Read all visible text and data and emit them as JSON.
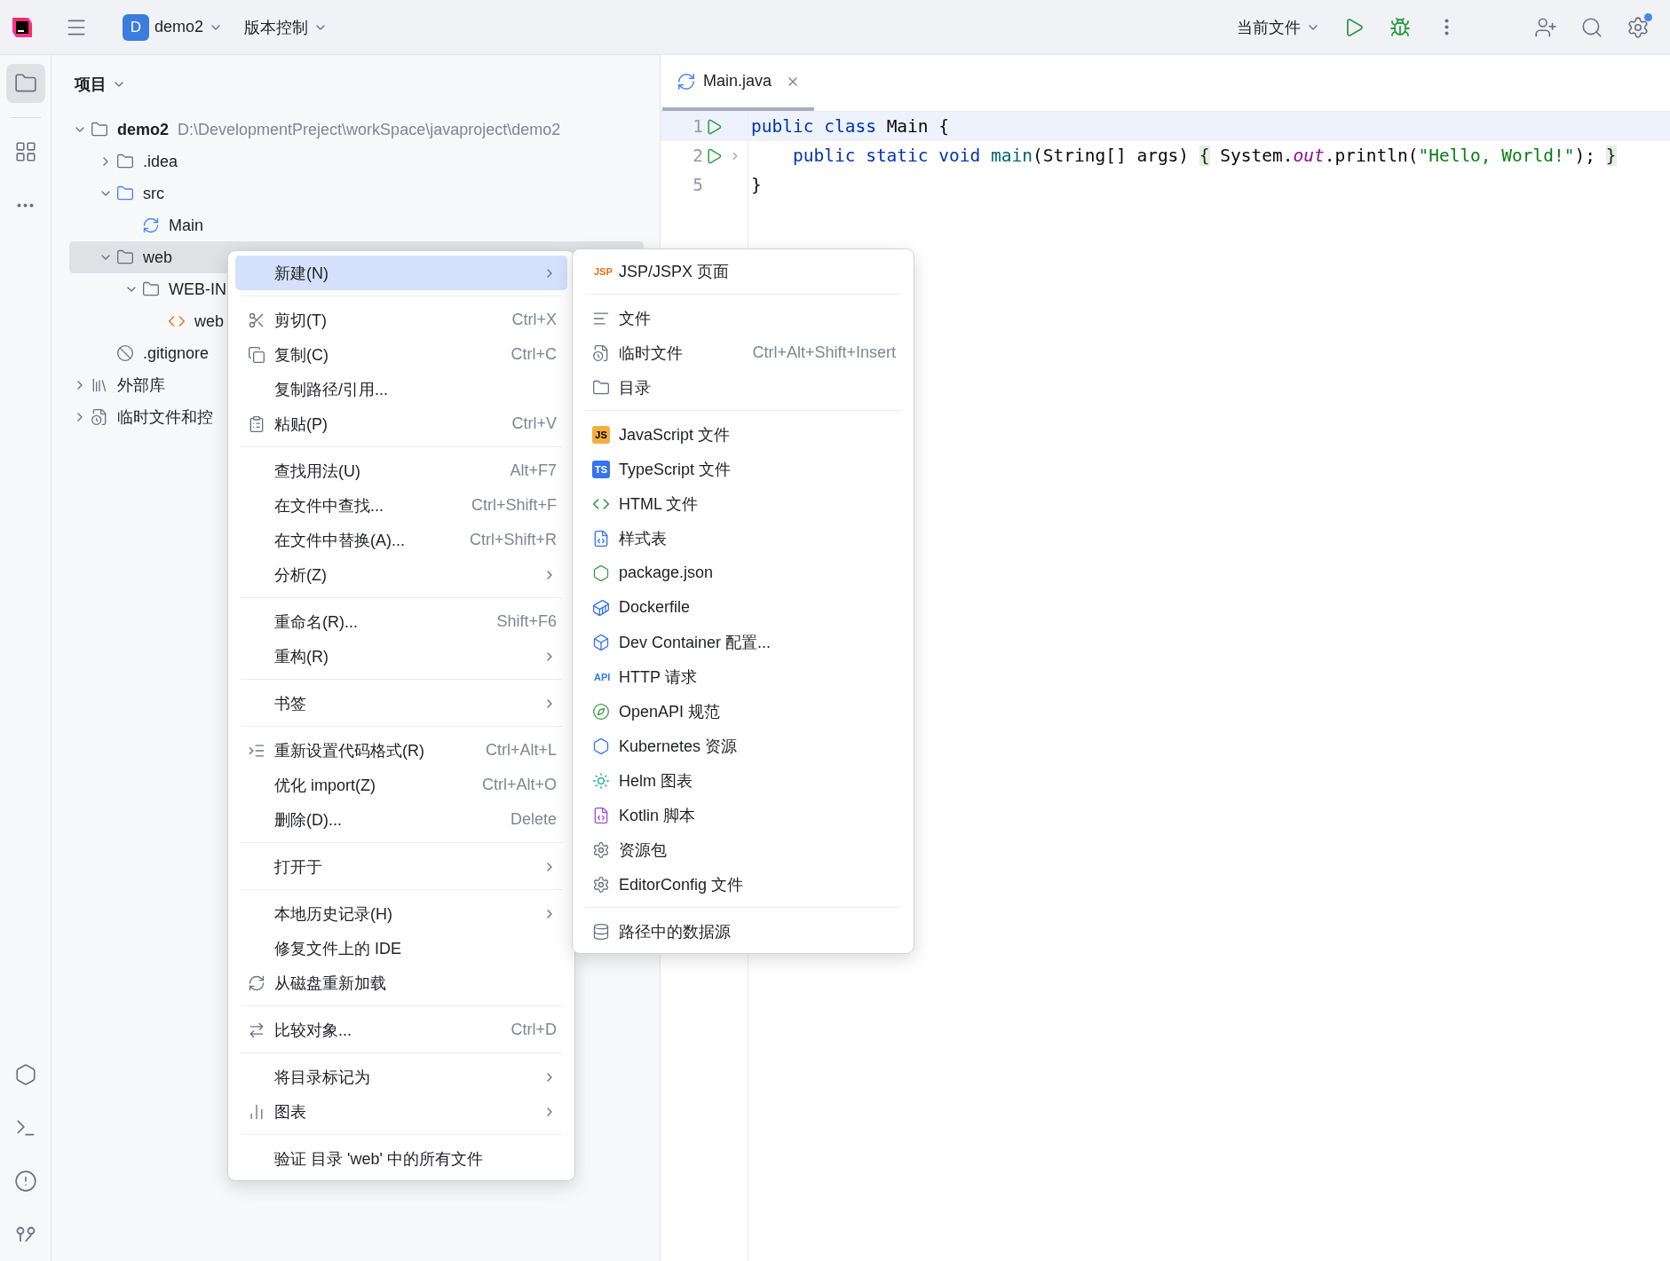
{
  "title_bar": {
    "project_badge": "D",
    "project": "demo2",
    "vcs": "版本控制",
    "run_config": "当前文件",
    "settings_notification": true
  },
  "tool_strip": {
    "top": [
      {
        "selected": true
      },
      {
        "selected": false
      },
      {
        "selected": false
      }
    ],
    "bottom": [
      {
        "selected": false
      },
      {
        "selected": false
      },
      {
        "selected": false
      },
      {
        "selected": false
      }
    ]
  },
  "project_panel": {
    "title": "项目",
    "tree": [
      {
        "kind": "module",
        "label": "demo2",
        "path": "D:\\DevelopmentPreject\\workSpace\\javaproject\\demo2",
        "expanded": true,
        "selected": false,
        "children": [
          {
            "kind": "folder",
            "label": ".idea",
            "expanded": false,
            "selected": false
          },
          {
            "kind": "source",
            "label": "src",
            "expanded": true,
            "selected": false,
            "children": [
              {
                "kind": "class",
                "label": "Main",
                "selected": false
              }
            ]
          },
          {
            "kind": "web",
            "label": "web",
            "expanded": true,
            "selected": true,
            "children": [
              {
                "kind": "folder",
                "label": "WEB-IN",
                "expanded": true,
                "selected": false,
                "children": [
                  {
                    "kind": "xml",
                    "label": "web",
                    "selected": false
                  }
                ]
              }
            ]
          },
          {
            "kind": "ignore",
            "label": ".gitignore",
            "selected": false
          }
        ]
      },
      {
        "kind": "library",
        "label": "外部库",
        "expanded": false,
        "selected": false
      },
      {
        "kind": "scratch",
        "label": "临时文件和控",
        "expanded": false,
        "selected": false
      }
    ]
  },
  "editor": {
    "tabs": [
      {
        "label": "Main.java",
        "selected": true
      }
    ],
    "lines": [
      {
        "number": "1",
        "runnable": true,
        "foldable": false,
        "current": true,
        "tokens": [
          {
            "kind": "kw",
            "text": "public class"
          },
          {
            "kind": "plain",
            "text": " Main {"
          }
        ]
      },
      {
        "number": "2",
        "runnable": true,
        "foldable": true,
        "current": false,
        "tokens": [
          {
            "kind": "kw",
            "text": "    public static void "
          },
          {
            "kind": "fn",
            "text": "main"
          },
          {
            "kind": "plain",
            "text": "(String[] args) "
          },
          {
            "kind": "fold",
            "text": "{"
          },
          {
            "kind": "plain",
            "text": " System."
          },
          {
            "kind": "field",
            "text": "out"
          },
          {
            "kind": "plain",
            "text": ".println("
          },
          {
            "kind": "str",
            "text": "\"Hello, World!\""
          },
          {
            "kind": "plain",
            "text": "); "
          },
          {
            "kind": "fold",
            "text": "}"
          }
        ]
      },
      {
        "number": "5",
        "runnable": false,
        "foldable": false,
        "current": false,
        "tokens": [
          {
            "kind": "plain",
            "text": "}"
          }
        ]
      }
    ]
  },
  "context_menu": {
    "groups": [
      [
        {
          "label": "新建(N)",
          "submenu": true,
          "selected": true
        }
      ],
      [
        {
          "label": "剪切(T)",
          "shortcut": "Ctrl+X",
          "selected": false
        },
        {
          "label": "复制(C)",
          "shortcut": "Ctrl+C",
          "selected": false
        },
        {
          "label": "复制路径/引用...",
          "selected": false
        },
        {
          "label": "粘贴(P)",
          "shortcut": "Ctrl+V",
          "selected": false
        }
      ],
      [
        {
          "label": "查找用法(U)",
          "shortcut": "Alt+F7",
          "selected": false
        },
        {
          "label": "在文件中查找...",
          "shortcut": "Ctrl+Shift+F",
          "selected": false
        },
        {
          "label": "在文件中替换(A)...",
          "shortcut": "Ctrl+Shift+R",
          "selected": false
        },
        {
          "label": "分析(Z)",
          "submenu": true,
          "selected": false
        }
      ],
      [
        {
          "label": "重命名(R)...",
          "shortcut": "Shift+F6",
          "selected": false
        },
        {
          "label": "重构(R)",
          "submenu": true,
          "selected": false
        }
      ],
      [
        {
          "label": "书签",
          "submenu": true,
          "selected": false
        }
      ],
      [
        {
          "label": "重新设置代码格式(R)",
          "shortcut": "Ctrl+Alt+L",
          "selected": false
        },
        {
          "label": "优化 import(Z)",
          "shortcut": "Ctrl+Alt+O",
          "selected": false
        },
        {
          "label": "删除(D)...",
          "shortcut": "Delete",
          "selected": false
        }
      ],
      [
        {
          "label": "打开于",
          "submenu": true,
          "selected": false
        }
      ],
      [
        {
          "label": "本地历史记录(H)",
          "submenu": true,
          "selected": false
        },
        {
          "label": "修复文件上的 IDE",
          "selected": false
        },
        {
          "label": "从磁盘重新加载",
          "selected": false
        }
      ],
      [
        {
          "label": "比较对象...",
          "shortcut": "Ctrl+D",
          "selected": false
        }
      ],
      [
        {
          "label": "将目录标记为",
          "submenu": true,
          "selected": false
        },
        {
          "label": "图表",
          "submenu": true,
          "selected": false
        }
      ],
      [
        {
          "label": "验证 目录 'web' 中的所有文件",
          "selected": false
        }
      ]
    ]
  },
  "new_submenu": {
    "groups": [
      [
        {
          "label": "JSP/JSPX 页面",
          "badge": "JSP",
          "selected": false
        }
      ],
      [
        {
          "label": "文件",
          "selected": false
        },
        {
          "label": "临时文件",
          "shortcut": "Ctrl+Alt+Shift+Insert",
          "selected": false
        },
        {
          "label": "目录",
          "selected": false
        }
      ],
      [
        {
          "label": "JavaScript 文件",
          "badge": "JS",
          "selected": false
        },
        {
          "label": "TypeScript 文件",
          "badge": "TS",
          "selected": false
        },
        {
          "label": "HTML 文件",
          "selected": false
        },
        {
          "label": "样式表",
          "selected": false
        },
        {
          "label": "package.json",
          "selected": false
        },
        {
          "label": "Dockerfile",
          "selected": false
        },
        {
          "label": "Dev Container 配置...",
          "selected": false
        },
        {
          "label": "HTTP 请求",
          "badge": "API",
          "selected": false
        },
        {
          "label": "OpenAPI 规范",
          "selected": false
        },
        {
          "label": "Kubernetes 资源",
          "selected": false
        },
        {
          "label": "Helm 图表",
          "selected": false
        },
        {
          "label": "Kotlin 脚本",
          "selected": false
        },
        {
          "label": "资源包",
          "selected": false
        },
        {
          "label": "EditorConfig 文件",
          "selected": false
        }
      ],
      [
        {
          "label": "路径中的数据源",
          "selected": false
        }
      ]
    ]
  }
}
